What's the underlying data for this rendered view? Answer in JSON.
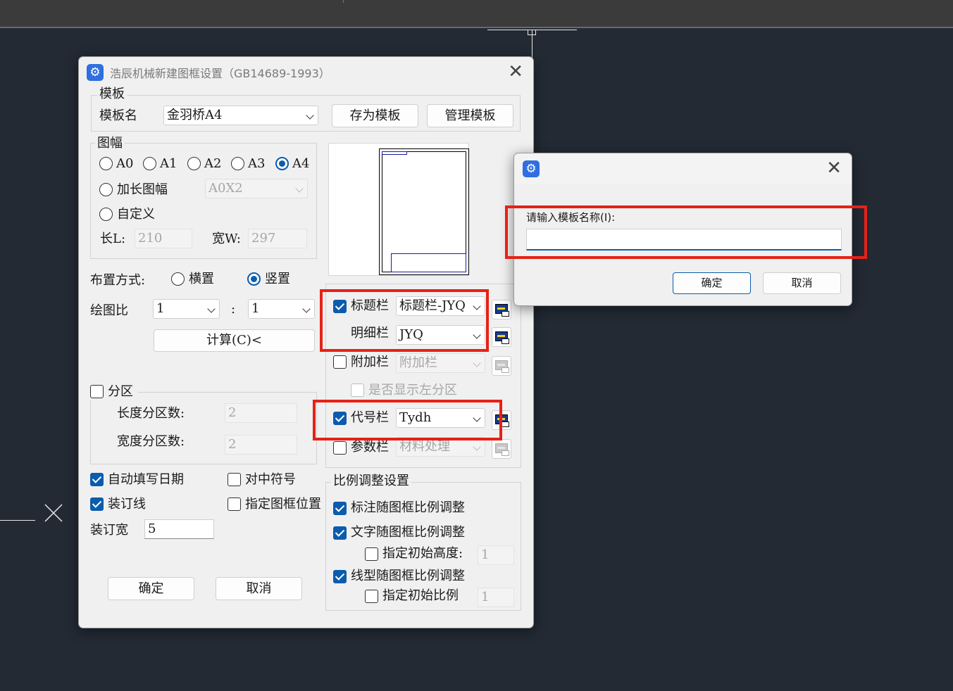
{
  "main_dialog": {
    "title": "浩辰机械新建图框设置（GB14689-1993）",
    "template_group": {
      "legend": "模板",
      "name_label": "模板名",
      "name_value": "金羽桥A4",
      "save_button": "存为模板",
      "manage_button": "管理模板"
    },
    "size_group": {
      "legend": "图幅",
      "radios": [
        "A0",
        "A1",
        "A2",
        "A3",
        "A4"
      ],
      "selected": "A4",
      "extended_label": "加长图幅",
      "extended_value": "A0X2",
      "custom_label": "自定义",
      "length_label": "长L:",
      "length_value": "210",
      "width_label": "宽W:",
      "width_value": "297"
    },
    "layout": {
      "label": "布置方式:",
      "horizontal": "横置",
      "vertical": "竖置",
      "selected": "竖置"
    },
    "scale": {
      "label": "绘图比",
      "left_value": "1",
      "colon": ":",
      "right_value": "1",
      "calc_button": "计算(C)<"
    },
    "zones": {
      "label": "分区",
      "checked": false,
      "length_label": "长度分区数:",
      "length_value": "2",
      "width_label": "宽度分区数:",
      "width_value": "2"
    },
    "options": {
      "auto_date": "自动填写日期",
      "auto_date_checked": true,
      "center_mark": "对中符号",
      "center_mark_checked": false,
      "binding_line": "装订线",
      "binding_line_checked": true,
      "frame_position": "指定图框位置",
      "frame_position_checked": false,
      "binding_width_label": "装订宽",
      "binding_width_value": "5"
    },
    "columns": {
      "title_block": "标题栏",
      "title_block_checked": true,
      "title_block_value": "标题栏-JYQ",
      "detail": "明细栏",
      "detail_value": "JYQ",
      "extra": "附加栏",
      "extra_checked": false,
      "extra_value": "附加栏",
      "show_left_zone": "是否显示左分区",
      "code": "代号栏",
      "code_checked": true,
      "code_value": "Tydh",
      "param": "参数栏",
      "param_checked": false,
      "param_value": "材料处理"
    },
    "scale_settings": {
      "legend": "比例调整设置",
      "dim_follow": "标注随图框比例调整",
      "text_follow": "文字随图框比例调整",
      "init_height": "指定初始高度:",
      "init_height_value": "1",
      "linetype_follow": "线型随图框比例调整",
      "init_scale": "指定初始比例",
      "init_scale_value": "1"
    },
    "ok_button": "确定",
    "cancel_button": "取消"
  },
  "name_dialog": {
    "prompt": "请输入模板名称(I):",
    "input_value": "",
    "ok_button": "确定",
    "cancel_button": "取消"
  },
  "colors": {
    "accent": "#0b5cad",
    "highlight": "#e62117",
    "canvas": "#232a34"
  }
}
